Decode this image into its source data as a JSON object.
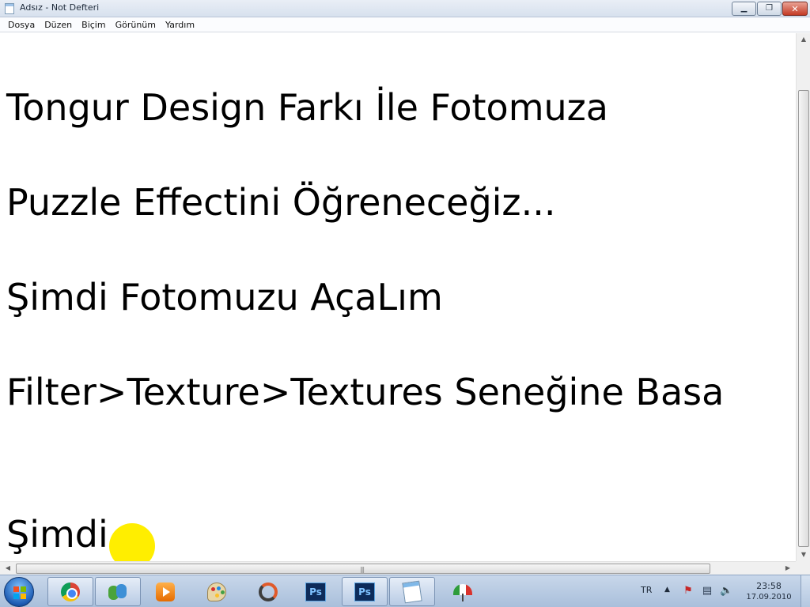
{
  "window": {
    "title": "Adsız - Not Defteri",
    "minimize_glyph": "▁",
    "maximize_glyph": "❐",
    "close_glyph": "✕"
  },
  "menu": {
    "items": [
      "Dosya",
      "Düzen",
      "Biçim",
      "Görünüm",
      "Yardım"
    ]
  },
  "editor": {
    "lines": [
      "Tongur Design Farkı İle Fotomuza",
      "Puzzle Effectini Öğreneceğiz...",
      "Şimdi Fotomuzu AçaLım",
      "Filter>Texture>Textures Seneğine Basa",
      "Şimdi"
    ]
  },
  "scrollbars": {
    "up_glyph": "▲",
    "down_glyph": "▼",
    "left_glyph": "◀",
    "right_glyph": "▶",
    "grip_glyph": "|||"
  },
  "taskbar": {
    "icons": [
      "start-orb",
      "chrome-icon",
      "messenger-icon",
      "media-player-icon",
      "paint-icon",
      "sync-icon",
      "photoshop-icon",
      "photoshop-icon",
      "notepad-icon",
      "umbrella-icon"
    ],
    "photoshop_label": "Ps"
  },
  "tray": {
    "language": "TR",
    "show_hidden_glyph": "▲",
    "action_center_glyph": "⚑",
    "network_glyph": "▤",
    "volume_glyph": "🔈",
    "time": "23:58",
    "date": "17.09.2010"
  },
  "colors": {
    "cursor_highlight": "#ffee00",
    "close_button": "#c43a24"
  }
}
